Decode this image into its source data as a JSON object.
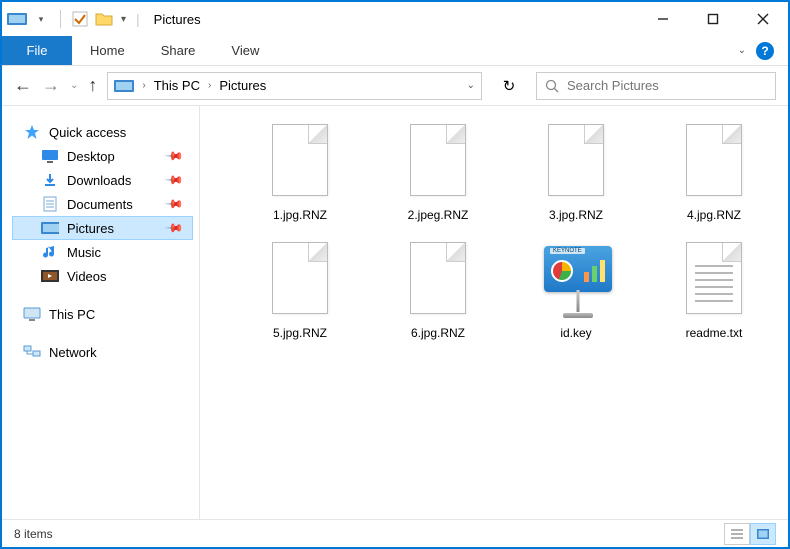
{
  "window_title": "Pictures",
  "ribbon": {
    "file_label": "File",
    "tabs": [
      "Home",
      "Share",
      "View"
    ]
  },
  "breadcrumb": {
    "items": [
      "This PC",
      "Pictures"
    ]
  },
  "search": {
    "placeholder": "Search Pictures"
  },
  "navpane": {
    "quick_access": {
      "label": "Quick access",
      "items": [
        {
          "label": "Desktop",
          "icon": "desktop",
          "pinned": true
        },
        {
          "label": "Downloads",
          "icon": "downloads",
          "pinned": true
        },
        {
          "label": "Documents",
          "icon": "documents",
          "pinned": true
        },
        {
          "label": "Pictures",
          "icon": "pictures",
          "pinned": true,
          "selected": true
        },
        {
          "label": "Music",
          "icon": "music",
          "pinned": false
        },
        {
          "label": "Videos",
          "icon": "videos",
          "pinned": false
        }
      ]
    },
    "this_pc_label": "This PC",
    "network_label": "Network"
  },
  "files": [
    {
      "name": "1.jpg.RNZ",
      "icon": "blank"
    },
    {
      "name": "2.jpeg.RNZ",
      "icon": "blank"
    },
    {
      "name": "3.jpg.RNZ",
      "icon": "blank"
    },
    {
      "name": "4.jpg.RNZ",
      "icon": "blank"
    },
    {
      "name": "5.jpg.RNZ",
      "icon": "blank"
    },
    {
      "name": "6.jpg.RNZ",
      "icon": "blank"
    },
    {
      "name": "id.key",
      "icon": "keynote"
    },
    {
      "name": "readme.txt",
      "icon": "text"
    }
  ],
  "statusbar": {
    "item_count_label": "8 items"
  }
}
